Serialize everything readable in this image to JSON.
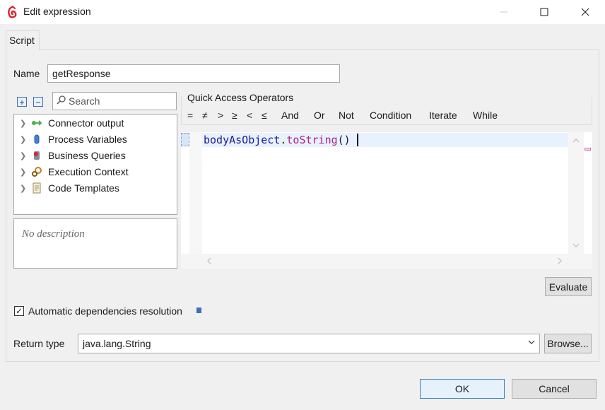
{
  "window": {
    "title": "Edit expression"
  },
  "tabs": [
    {
      "label": "Script"
    }
  ],
  "name_field": {
    "label": "Name",
    "value": "getResponse"
  },
  "search": {
    "placeholder": "Search"
  },
  "tree": {
    "items": [
      {
        "label": "Connector output",
        "icon": "connector-icon"
      },
      {
        "label": "Process Variables",
        "icon": "variable-icon"
      },
      {
        "label": "Business Queries",
        "icon": "query-icon"
      },
      {
        "label": "Execution Context",
        "icon": "gears-icon"
      },
      {
        "label": "Code Templates",
        "icon": "template-icon"
      }
    ]
  },
  "description": "No description",
  "quick_access": {
    "title": "Quick Access Operators",
    "operators": [
      "=",
      "≠",
      ">",
      "≥",
      "<",
      "≤",
      "And",
      "Or",
      "Not",
      "Condition",
      "Iterate",
      "While"
    ]
  },
  "editor": {
    "code_object": "bodyAsObject",
    "code_dot": ".",
    "code_method": "toString",
    "code_parens": "()"
  },
  "buttons": {
    "evaluate": "Evaluate",
    "browse": "Browse...",
    "ok": "OK",
    "cancel": "Cancel"
  },
  "auto_deps": {
    "label": "Automatic dependencies resolution",
    "checked": true
  },
  "return_type": {
    "label": "Return type",
    "value": "java.lang.String"
  },
  "colors": {
    "accent": "#3c7fb1",
    "code_object": "#1a1a9a",
    "code_method": "#b0208a"
  }
}
